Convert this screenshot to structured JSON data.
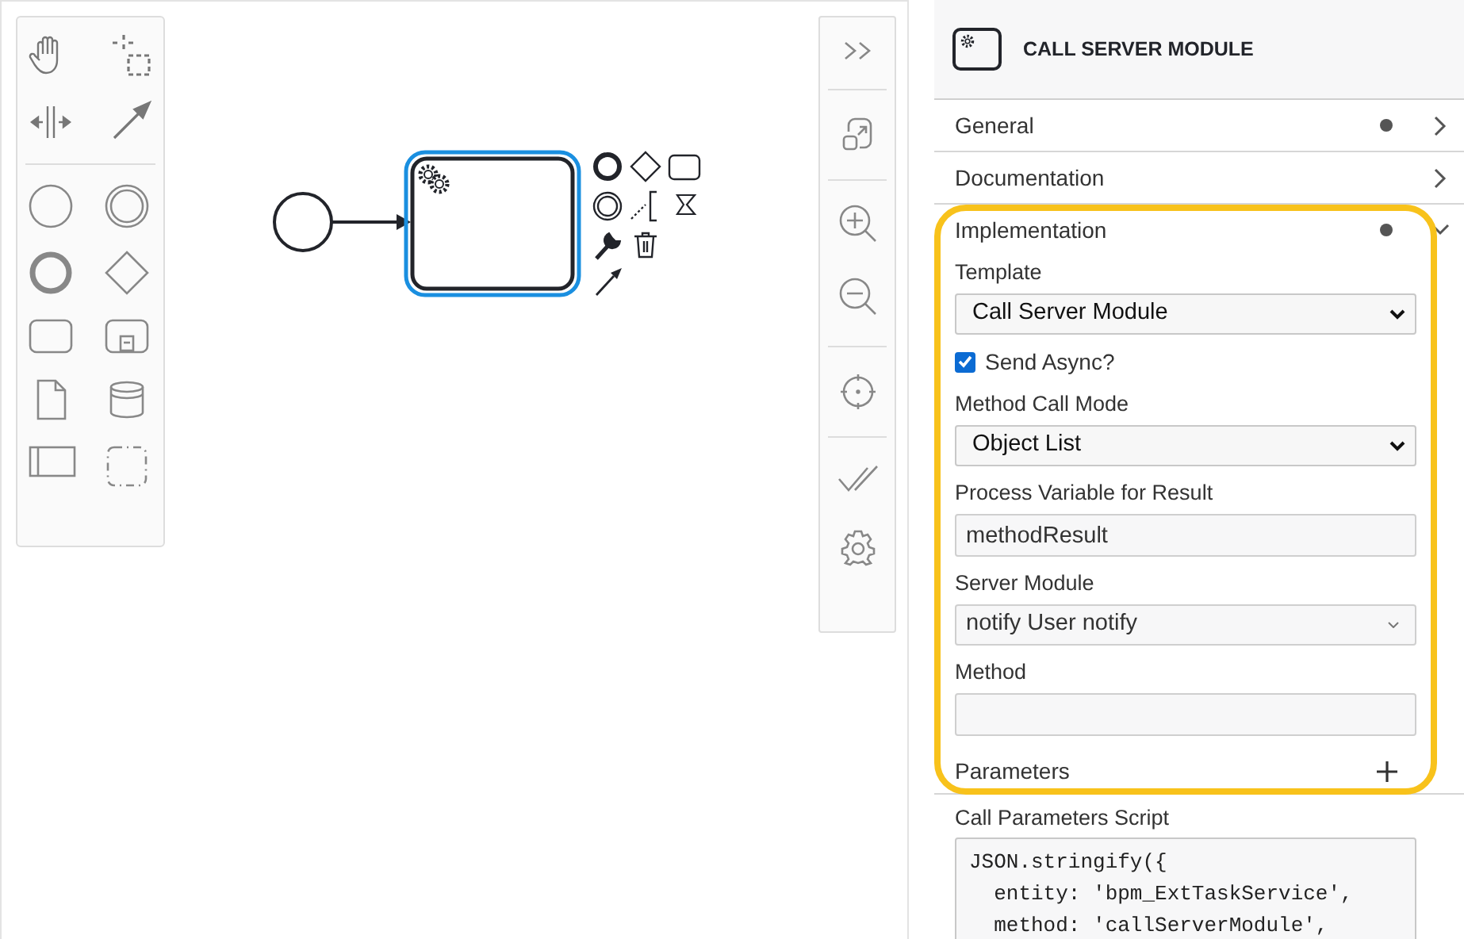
{
  "canvas": {
    "task": {
      "selected": true
    }
  },
  "properties_panel": {
    "title": "CALL SERVER MODULE",
    "groups": [
      {
        "label": "General",
        "has_changes": true,
        "expanded": false
      },
      {
        "label": "Documentation",
        "has_changes": false,
        "expanded": false
      },
      {
        "label": "Implementation",
        "has_changes": true,
        "expanded": true,
        "highlighted": true,
        "fields": [
          {
            "kind": "select",
            "label": "Template",
            "value": "Call Server Module"
          },
          {
            "kind": "checkbox",
            "label": "Send Async?",
            "checked": true
          },
          {
            "kind": "select",
            "label": "Method Call Mode",
            "value": "Object List"
          },
          {
            "kind": "text",
            "label": "Process Variable for Result",
            "value": "methodResult"
          },
          {
            "kind": "combo",
            "label": "Server Module",
            "value": "notify User notify"
          },
          {
            "kind": "text",
            "label": "Method"
          }
        ],
        "list": {
          "label": "Parameters"
        }
      }
    ],
    "script": {
      "label": "Call Parameters Script",
      "lines": [
        "JSON.stringify({",
        "  entity: 'bpm_ExtTaskService',",
        "  method: 'callServerModule',"
      ]
    }
  }
}
